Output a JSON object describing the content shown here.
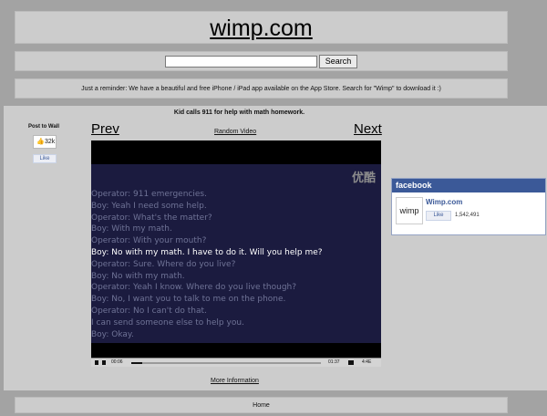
{
  "header": {
    "site_title": "wimp.com"
  },
  "search": {
    "value": "",
    "placeholder": "",
    "button_label": "Search"
  },
  "reminder": {
    "text": "Just a reminder: We have a beautiful and free iPhone / iPad app available on the App Store. Search for \"Wimp\" to download it :)"
  },
  "video": {
    "title": "Kid calls 911 for help with math homework.",
    "prev_label": "Prev",
    "next_label": "Next",
    "random_label": "Random Video",
    "logo_text": "优酷",
    "subtitles": [
      {
        "text": "Operator: 911 emergencies.",
        "highlight": false
      },
      {
        "text": "Boy: Yeah I need some help.",
        "highlight": false
      },
      {
        "text": "Operator: What's the matter?",
        "highlight": false
      },
      {
        "text": "Boy: With my math.",
        "highlight": false
      },
      {
        "text": "Operator: With your mouth?",
        "highlight": false
      },
      {
        "text": "Boy: No with my math. I have to do it. Will you help me?",
        "highlight": true
      },
      {
        "text": "Operator: Sure. Where do you live?",
        "highlight": false
      },
      {
        "text": "Boy: No with my math.",
        "highlight": false
      },
      {
        "text": "Operator: Yeah I know. Where do you live though?",
        "highlight": false
      },
      {
        "text": "Boy: No, I want you to talk to me on the phone.",
        "highlight": false
      },
      {
        "text": "Operator: No I can't do that.",
        "highlight": false
      },
      {
        "text": "I can send someone else to help you.",
        "highlight": false
      },
      {
        "text": "Boy: Okay.",
        "highlight": false
      }
    ],
    "time_current": "00:06",
    "time_total": "01:37",
    "size_label": "4:4E",
    "progress": 0.06,
    "more_info_label": "More Information"
  },
  "share": {
    "post_to_wall": "Post to Wall",
    "like_count": "32k",
    "like_thumb_icon": "thumbs-up-icon",
    "like_label": "Like"
  },
  "facebook": {
    "header": "facebook",
    "avatar_text": "wimp",
    "page_name": "Wimp.com",
    "like_label": "Like",
    "like_count": "1,542,491",
    "brand_color": "#3b5998"
  },
  "footer": {
    "home_label": "Home"
  },
  "colors": {
    "page_bg": "#a3a3a3",
    "band_bg": "#cccccc",
    "video_bg": "#1b1b3f"
  }
}
